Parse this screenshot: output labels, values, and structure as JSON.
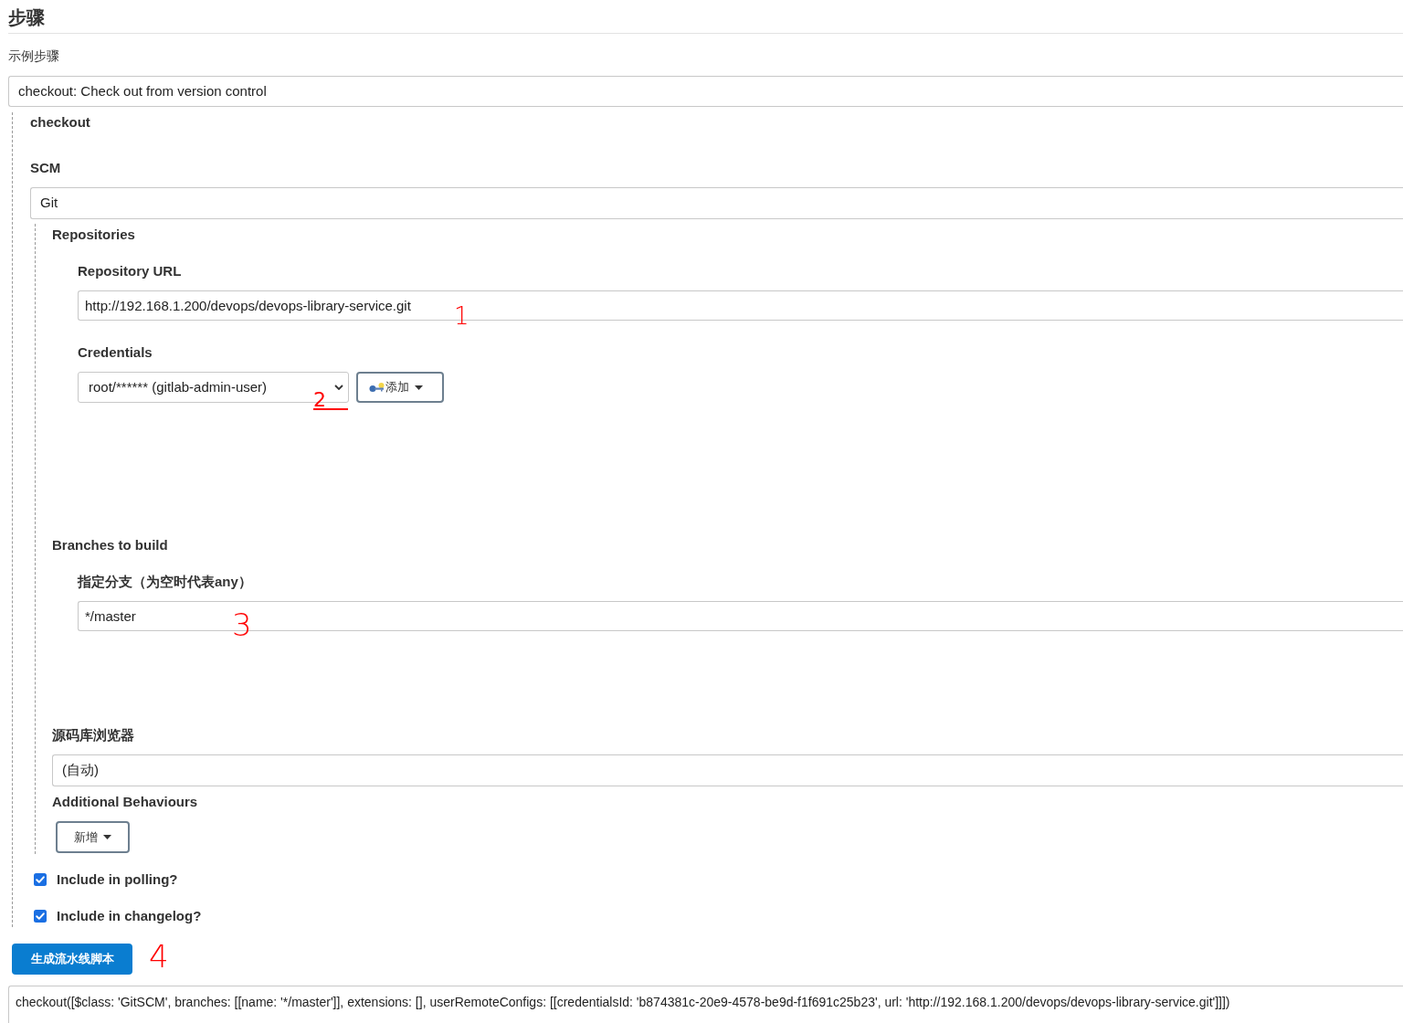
{
  "heading": "步骤",
  "sample_step": {
    "label": "示例步骤",
    "value": "checkout: Check out from version control"
  },
  "checkout": {
    "title": "checkout",
    "scm": {
      "label": "SCM",
      "value": "Git"
    },
    "repositories": {
      "label": "Repositories",
      "url": {
        "label": "Repository URL",
        "value": "http://192.168.1.200/devops/devops-library-service.git"
      },
      "credentials": {
        "label": "Credentials",
        "value": "root/****** (gitlab-admin-user)",
        "add_button": "添加"
      }
    },
    "branches": {
      "label": "Branches to build",
      "specifier": {
        "label": "指定分支（为空时代表any）",
        "value": "*/master"
      }
    },
    "repository_browser": {
      "label": "源码库浏览器",
      "value": "(自动)"
    },
    "additional_behaviours": {
      "label": "Additional Behaviours",
      "add_button": "新增"
    },
    "options": [
      {
        "label": "Include in polling?",
        "checked": true
      },
      {
        "label": "Include in changelog?",
        "checked": true
      }
    ]
  },
  "generate_button": "生成流水线脚本",
  "generated_script": "checkout([$class: 'GitSCM', branches: [[name: '*/master']], extensions: [], userRemoteConfigs: [[credentialsId: 'b874381c-20e9-4578-be9d-f1f691c25b23', url: 'http://192.168.1.200/devops/devops-library-service.git']]])",
  "annotations": [
    {
      "label": "1"
    },
    {
      "label": "2"
    },
    {
      "label": "3"
    },
    {
      "label": "4"
    }
  ]
}
